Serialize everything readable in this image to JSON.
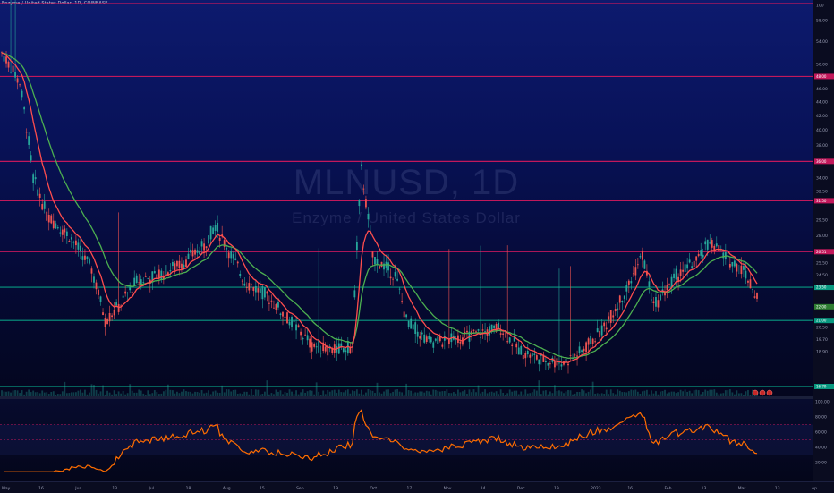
{
  "ticker": {
    "label": "Enzyme / United States Dollar, 1D, COINBASE",
    "symbol": "MLNUSD, 1D",
    "description": "Enzyme / United States Dollar"
  },
  "price_axis": {
    "ticks": [
      "100",
      "58.00",
      "54.00",
      "50.00",
      "46.00",
      "44.00",
      "42.00",
      "40.00",
      "38.00",
      "34.00",
      "32.50",
      "29.50",
      "28.00",
      "25.50",
      "24.50",
      "19.70",
      "20.50",
      "18.90",
      "16.79"
    ],
    "tick_values": [
      100,
      58,
      54,
      50,
      46,
      44,
      42,
      40,
      38,
      34,
      32.5,
      29.5,
      28,
      25.5,
      24.5,
      19.7,
      20.5,
      18.9,
      16.79
    ],
    "levels": [
      {
        "label": "100",
        "value": 100,
        "color": "#c2185b"
      },
      {
        "label": "48.00",
        "value": 48,
        "color": "#c2185b"
      },
      {
        "label": "36.00",
        "value": 36,
        "color": "#c2185b"
      },
      {
        "label": "31.50",
        "value": 31.5,
        "color": "#c2185b"
      },
      {
        "label": "26.51",
        "value": 26.51,
        "color": "#c2185b"
      },
      {
        "label": "23.50",
        "value": 23.5,
        "color": "#089981"
      },
      {
        "label": "21.00",
        "value": 21.0,
        "color": "#089981"
      },
      {
        "label": "16.79",
        "value": 16.79,
        "color": "#089981"
      }
    ],
    "current_price_label": "22.00",
    "current_price": 22.0,
    "current_price_color": "#2e7d32"
  },
  "rsi_axis": {
    "ticks": [
      "100.00",
      "80.00",
      "60.00",
      "40.00",
      "20.00"
    ],
    "tick_values": [
      100,
      80,
      60,
      40,
      20
    ],
    "bands": [
      70,
      50,
      30
    ]
  },
  "time_axis": {
    "labels": [
      "May",
      "16",
      "Jun",
      "13",
      "Jul",
      "18",
      "Aug",
      "15",
      "Sep",
      "19",
      "Oct",
      "17",
      "Nov",
      "14",
      "Dec",
      "19",
      "2023",
      "16",
      "Feb",
      "13",
      "Mar",
      "13",
      "Ap"
    ]
  },
  "colors": {
    "bull": "#26a69a",
    "bear": "#ef5350",
    "ema_fast": "#ff4d4d",
    "ema_slow": "#4caf50",
    "rsi": "#ff6d00",
    "resistance": "#c2185b",
    "support": "#089981"
  },
  "icons": [
    "alert-icon",
    "clock-icon",
    "eye-icon"
  ]
}
